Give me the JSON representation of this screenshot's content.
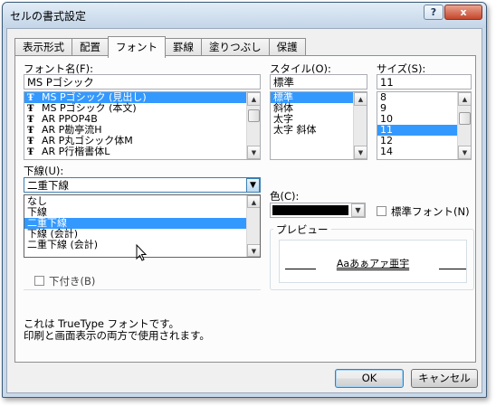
{
  "window": {
    "title": "セルの書式設定",
    "help_label": "?",
    "close_label": "x"
  },
  "tabs": [
    {
      "label": "表示形式"
    },
    {
      "label": "配置"
    },
    {
      "label": "フォント"
    },
    {
      "label": "罫線"
    },
    {
      "label": "塗りつぶし"
    },
    {
      "label": "保護"
    }
  ],
  "font_name": {
    "label": "フォント名(F):",
    "value": "MS Pゴシック",
    "items": [
      {
        "label": "MS Pゴシック (見出し)",
        "selected": true
      },
      {
        "label": "MS Pゴシック (本文)",
        "selected": false
      },
      {
        "label": "AR PPOP4B",
        "selected": false
      },
      {
        "label": "AR P勘亭流H",
        "selected": false
      },
      {
        "label": "AR P丸ゴシック体M",
        "selected": false
      },
      {
        "label": "AR P行楷書体L",
        "selected": false
      }
    ]
  },
  "style": {
    "label": "スタイル(O):",
    "value": "標準",
    "items": [
      {
        "label": "標準",
        "selected": true
      },
      {
        "label": "斜体",
        "selected": false
      },
      {
        "label": "太字",
        "selected": false
      },
      {
        "label": "太字 斜体",
        "selected": false
      }
    ]
  },
  "size": {
    "label": "サイズ(S):",
    "value": "11",
    "items": [
      {
        "label": "8",
        "selected": false
      },
      {
        "label": "9",
        "selected": false
      },
      {
        "label": "10",
        "selected": false
      },
      {
        "label": "11",
        "selected": true
      },
      {
        "label": "12",
        "selected": false
      },
      {
        "label": "14",
        "selected": false
      }
    ]
  },
  "underline": {
    "label": "下線(U):",
    "value": "二重下線",
    "options": [
      {
        "label": "なし",
        "selected": false
      },
      {
        "label": "下線",
        "selected": false
      },
      {
        "label": "二重下線",
        "selected": true
      },
      {
        "label": "下線 (会計)",
        "selected": false
      },
      {
        "label": "二重下線 (会計)",
        "selected": false
      }
    ],
    "partial_hidden_label": "下付き(B)"
  },
  "color": {
    "label": "色(C):",
    "value": "#000000"
  },
  "normal_font": {
    "label": "標準フォント(N)",
    "checked": false
  },
  "preview": {
    "label": "プレビュー",
    "sample": "Aaあぁアァ亜宇"
  },
  "info_text": [
    "これは TrueType フォントです。",
    "印刷と画面表示の両方で使用されます。"
  ],
  "buttons": {
    "ok": "OK",
    "cancel": "キャンセル"
  },
  "colors": {
    "selection": "#3399ff",
    "title_bar": "#c9d9ea",
    "close_button": "#c5462d"
  }
}
